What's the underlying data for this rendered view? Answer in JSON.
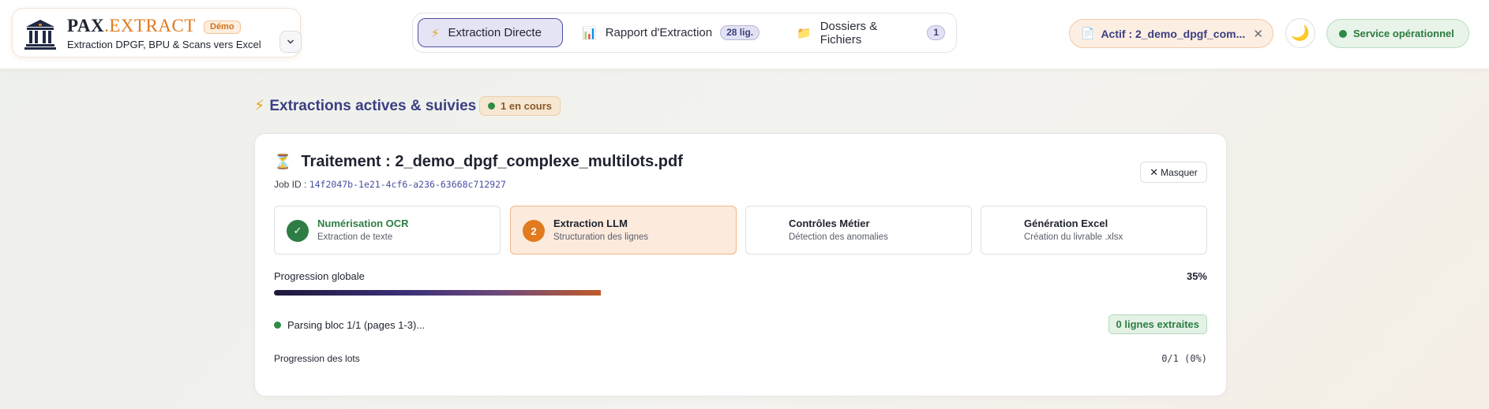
{
  "brand": {
    "name_part1": "Pax",
    "name_part2": ".Extract",
    "badge": "Démo",
    "subtitle": "Extraction DPGF, BPU & Scans vers Excel",
    "logo_icon": "bank-building-icon"
  },
  "nav": {
    "tabs": [
      {
        "icon": "⚡",
        "label": "Extraction Directe",
        "active": true
      },
      {
        "icon": "📊",
        "label": "Rapport d'Extraction",
        "count": "28 lig."
      },
      {
        "icon": "📁",
        "label": "Dossiers & Fichiers",
        "count": "1"
      }
    ]
  },
  "header": {
    "active_file": "Actif : 2_demo_dpgf_com...",
    "active_file_icon": "📄",
    "close": "✕",
    "theme_icon": "🌙",
    "status": "Service opérationnel"
  },
  "section": {
    "icon": "⚡",
    "title": "Extractions actives & suivies (1)",
    "badge": "1 en cours"
  },
  "job": {
    "icon": "⏳",
    "title": "Traitement : 2_demo_dpgf_complexe_multilots.pdf",
    "id_label": "Job ID :",
    "id_value": "14f2047b-1e21-4cf6-a236-63668c712927",
    "hide_label": "Masquer",
    "steps": [
      {
        "num": "✓",
        "title": "Numérisation OCR",
        "sub": "Extraction de texte",
        "state": "done"
      },
      {
        "num": "2",
        "title": "Extraction LLM",
        "sub": "Structuration des lignes",
        "state": "current"
      },
      {
        "num": "",
        "title": "Contrôles Métier",
        "sub": "Détection des anomalies",
        "state": "pending"
      },
      {
        "num": "",
        "title": "Génération Excel",
        "sub": "Création du livrable .xlsx",
        "state": "pending"
      }
    ],
    "progress_label": "Progression globale",
    "progress_pct": "35%",
    "progress_value": 0.35,
    "parse_status": "Parsing bloc 1/1 (pages 1-3)...",
    "lines_badge": "0 lignes extraites",
    "lots_label": "Progression des lots",
    "lots_value": "0/1 (0%)"
  },
  "colors": {
    "accent": "#4a4ea0",
    "orange": "#e27a1e",
    "success": "#2e7d45"
  }
}
